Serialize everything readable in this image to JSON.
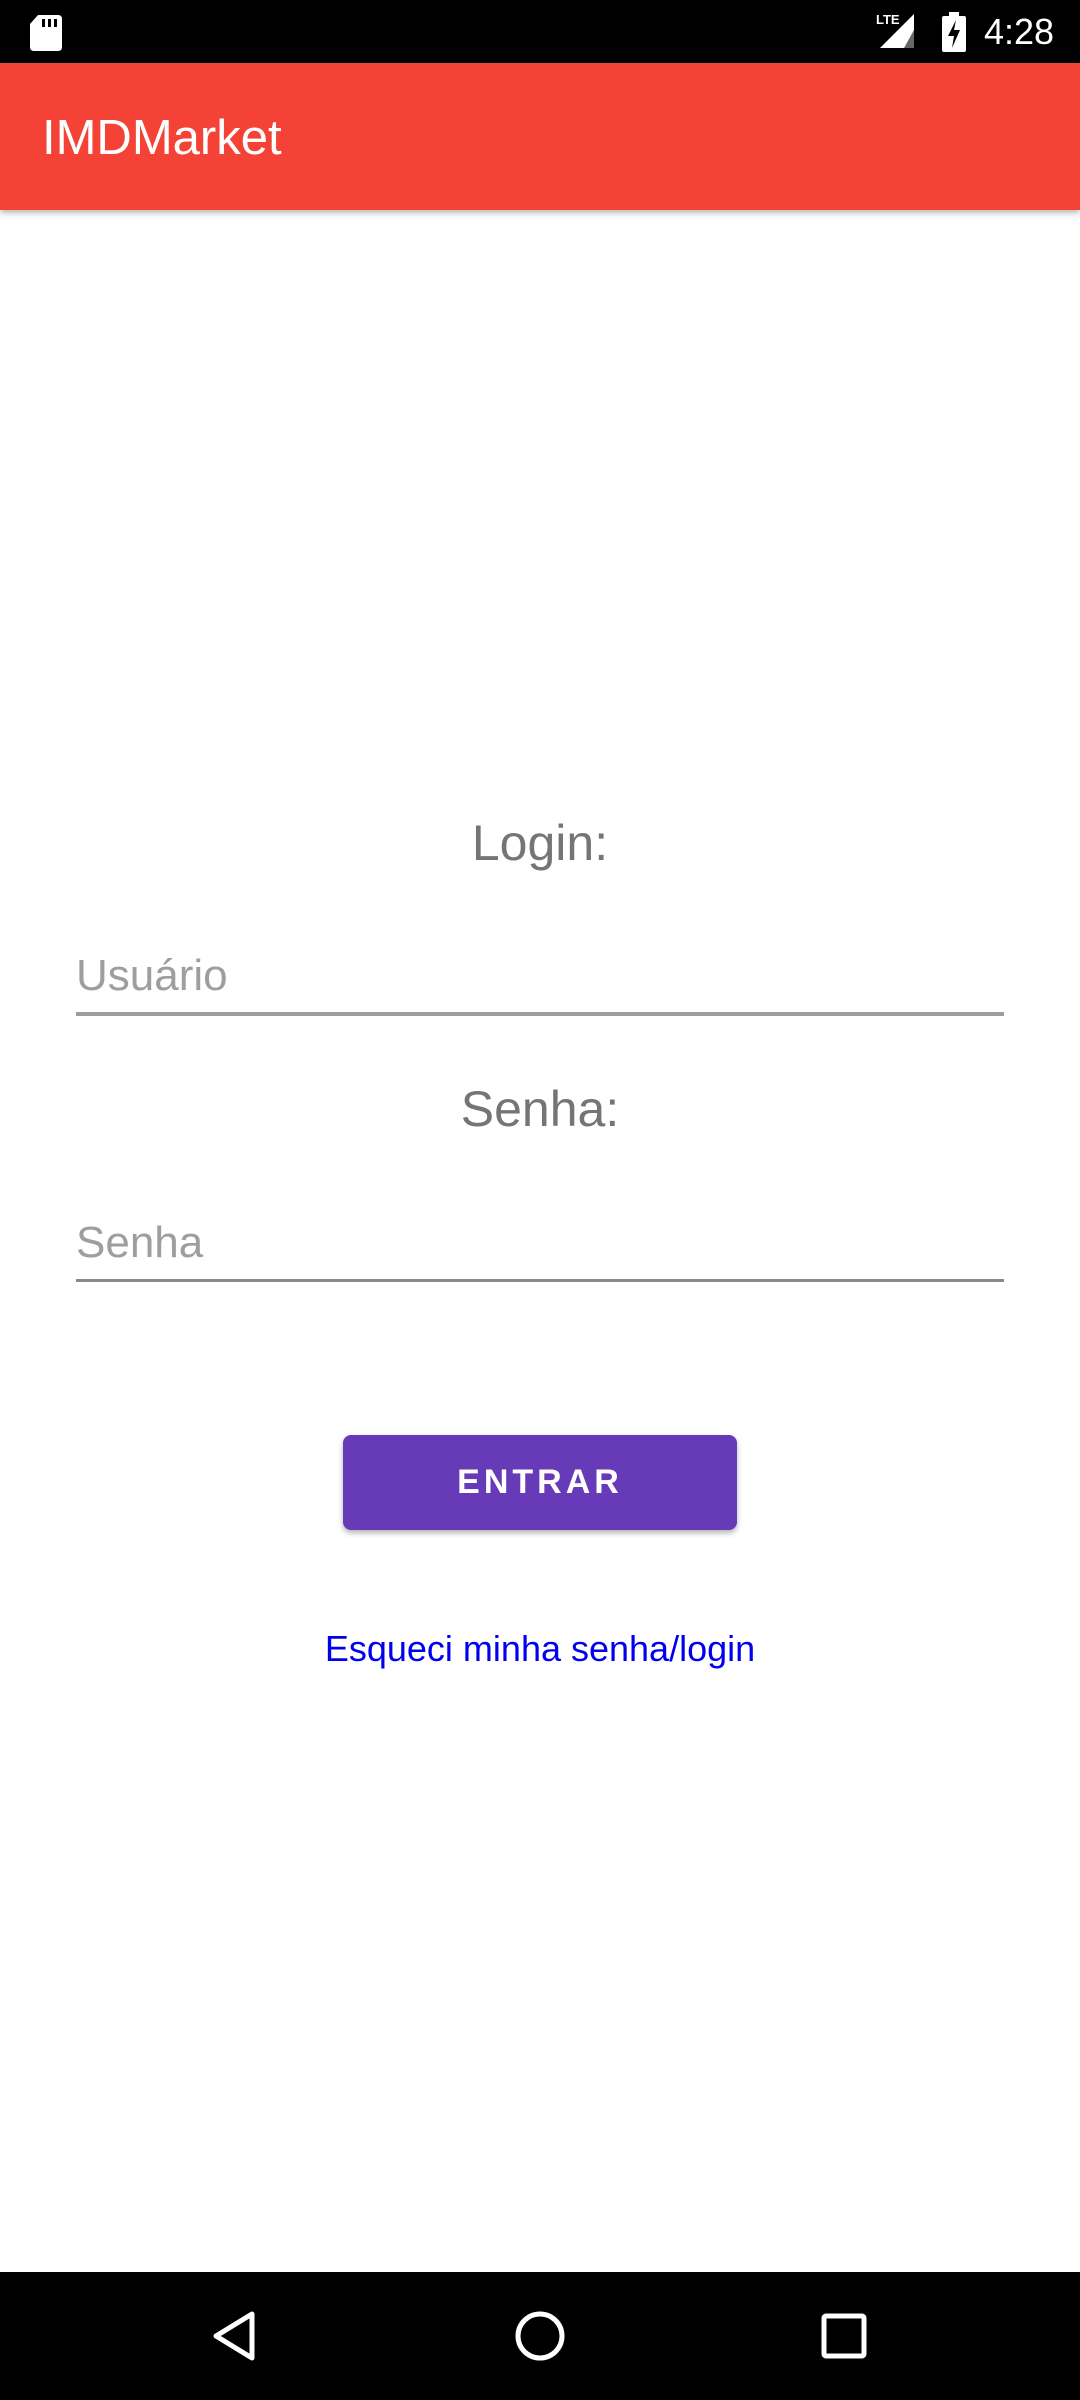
{
  "status_bar": {
    "time": "4:28",
    "network_label": "LTE",
    "icons": [
      "sd-card-icon",
      "lte-signal-icon",
      "battery-charging-icon"
    ]
  },
  "app_bar": {
    "title": "IMDMarket",
    "color": "#f44336"
  },
  "form": {
    "login_label": "Login:",
    "username_placeholder": "Usuário",
    "username_value": "",
    "password_label": "Senha:",
    "password_placeholder": "Senha",
    "password_value": "",
    "submit_label": "ENTRAR",
    "submit_color": "#673ab7",
    "forgot_link": "Esqueci minha senha/login"
  },
  "nav_bar": {
    "icons": [
      "back-icon",
      "home-icon",
      "recents-icon"
    ]
  }
}
